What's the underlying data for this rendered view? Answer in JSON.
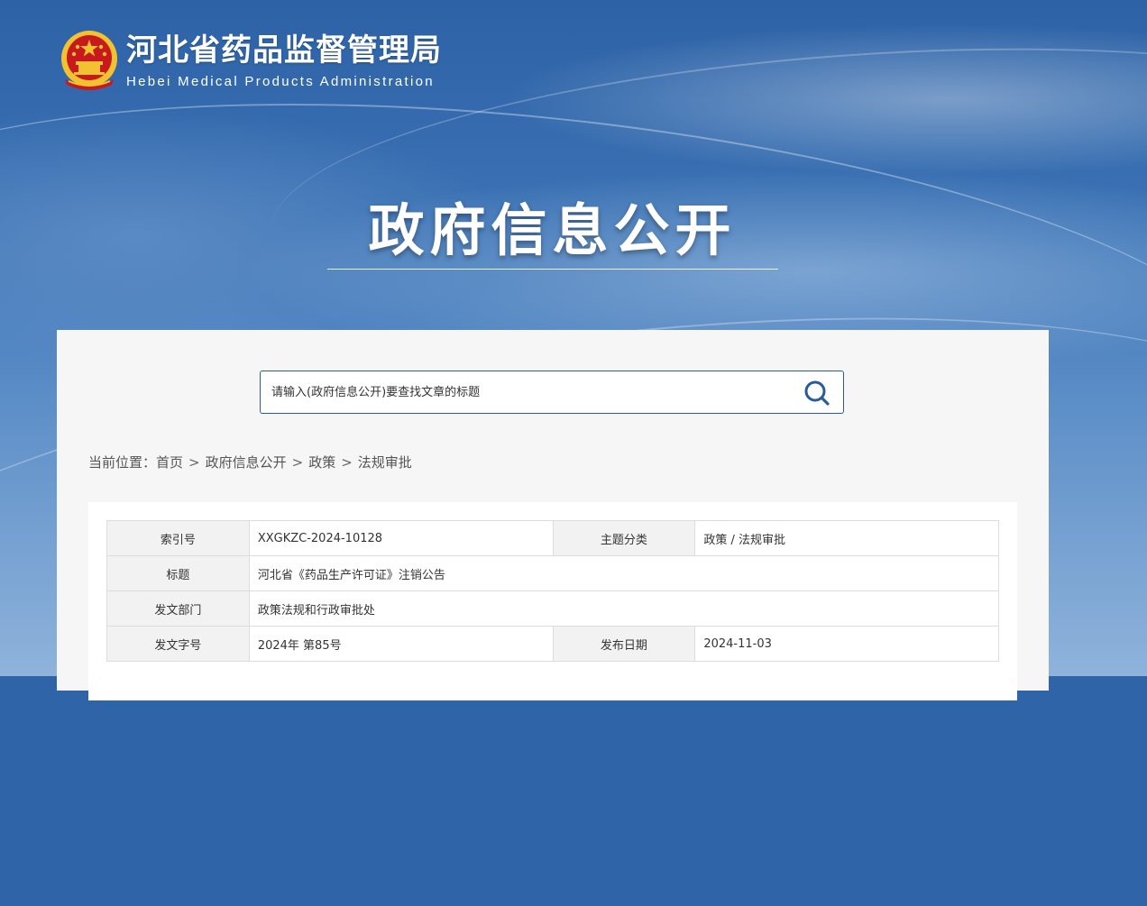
{
  "header": {
    "site_title": "河北省药品监督管理局",
    "site_subtitle": "Hebei Medical Products Administration",
    "emblem_icon": "national-emblem-icon"
  },
  "hero": {
    "title": "政府信息公开"
  },
  "search": {
    "placeholder": "请输入(政府信息公开)要查找文章的标题",
    "button_icon": "search-icon"
  },
  "breadcrumb": {
    "prefix": "当前位置：",
    "items": [
      "首页",
      "政府信息公开",
      "政策",
      "法规审批"
    ],
    "separator": ">"
  },
  "meta_table": {
    "rows": [
      {
        "label": "索引号",
        "value": "XXGKZC-2024-10128",
        "label2": "主题分类",
        "value2": "政策 / 法规审批"
      },
      {
        "label": "标题",
        "value": "河北省《药品生产许可证》注销公告"
      },
      {
        "label": "发文部门",
        "value": "政策法规和行政审批处"
      },
      {
        "label": "发文字号",
        "value": "2024年 第85号",
        "label2": "发布日期",
        "value2": "2024-11-03"
      }
    ]
  },
  "colors": {
    "banner_blue": "#2f65a8",
    "search_border": "#2a5a9a",
    "emblem_red": "#c8191e",
    "emblem_gold": "#f2c230"
  }
}
